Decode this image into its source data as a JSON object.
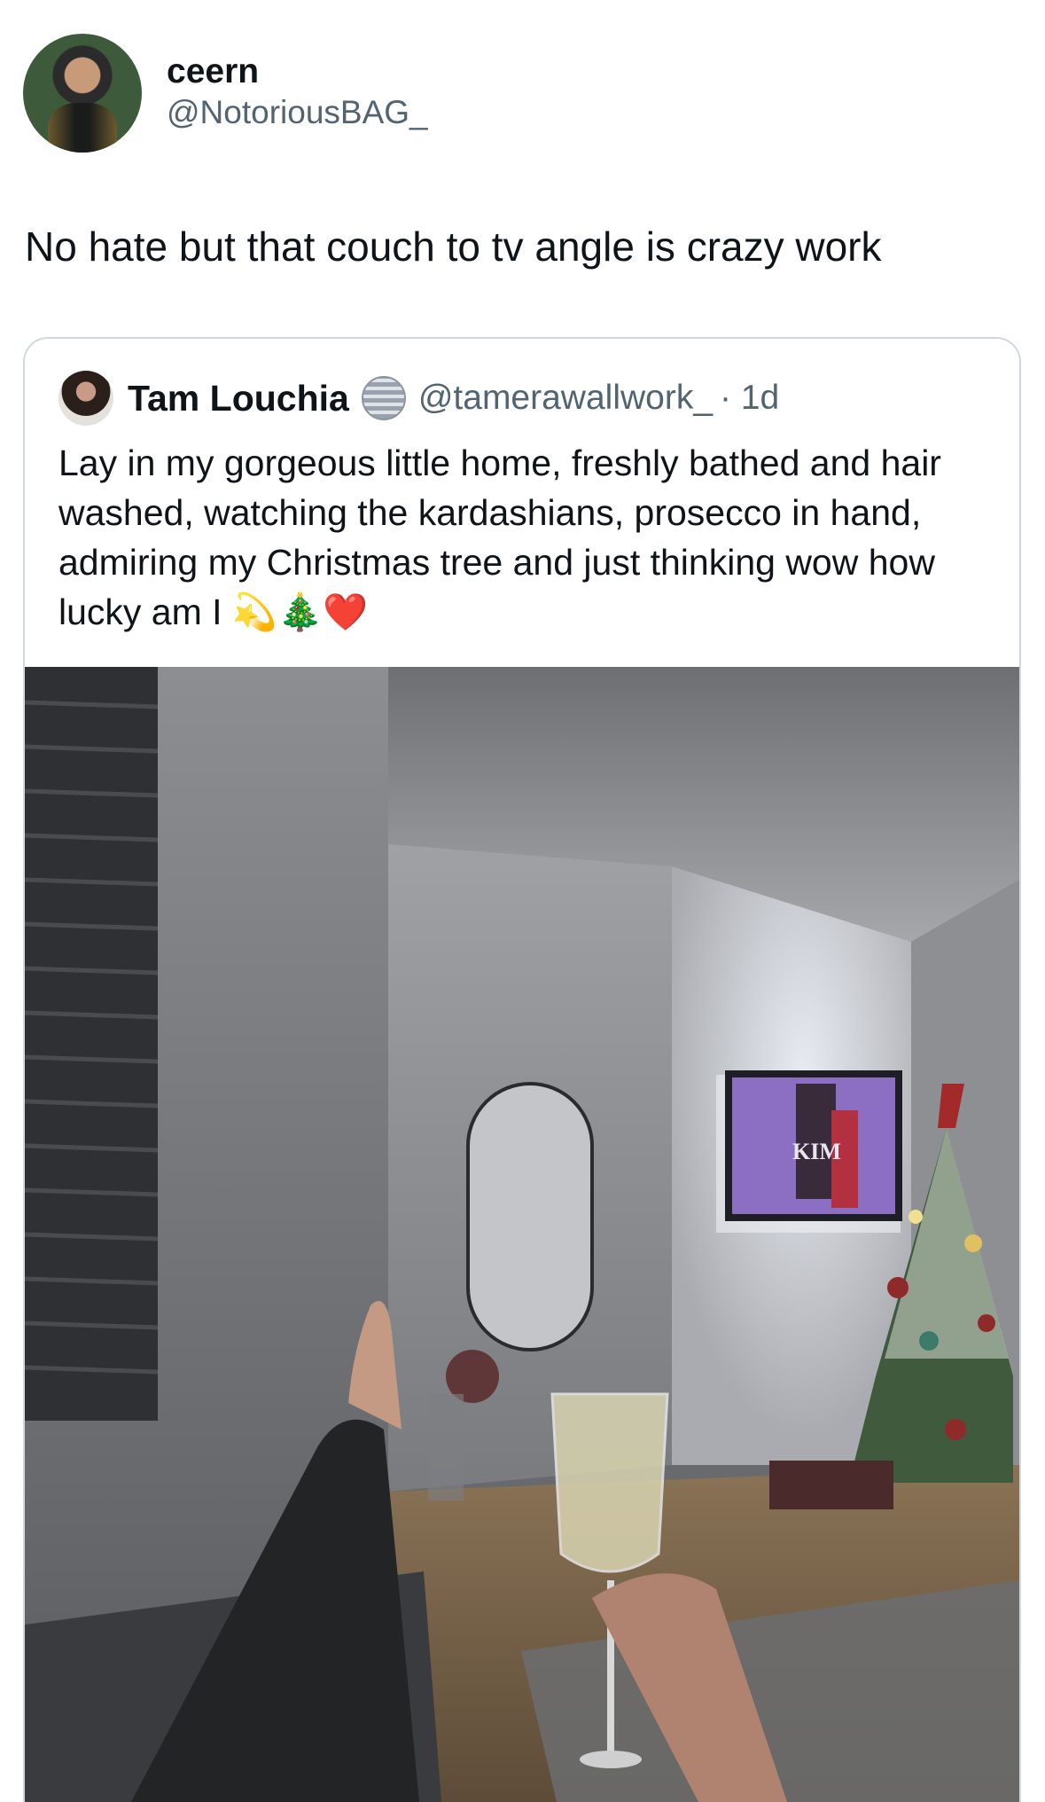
{
  "tweet": {
    "author_name": "ceern",
    "author_handle": "@NotoriousBAG_",
    "text": "No hate but that couch to tv angle is crazy work"
  },
  "quoted_tweet": {
    "author_name": "Tam Louchia",
    "author_handle": "@tamerawallwork_",
    "time": "· 1d",
    "text": "Lay in my gorgeous little home, freshly bathed and hair washed, watching the kardashians, prosecco in hand, admiring my Christmas tree and just thinking wow how lucky am I 💫🎄❤️",
    "tv_caption": "KIM"
  }
}
